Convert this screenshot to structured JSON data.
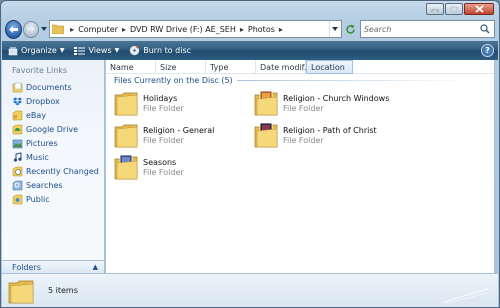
{
  "window": {
    "caption_buttons": [
      "minimize",
      "maximize",
      "close"
    ]
  },
  "address": {
    "crumbs": [
      "Computer",
      "DVD RW Drive (F:) AE_SEH",
      "Photos"
    ],
    "search_placeholder": "Search"
  },
  "toolbar": {
    "organize": "Organize",
    "views": "Views",
    "burn": "Burn to disc",
    "help": "?"
  },
  "nav": {
    "title": "Favorite Links",
    "items": [
      {
        "label": "Documents",
        "icon": "documents-icon"
      },
      {
        "label": "Dropbox",
        "icon": "dropbox-icon"
      },
      {
        "label": "eBay",
        "icon": "ebay-icon"
      },
      {
        "label": "Google Drive",
        "icon": "google-drive-icon"
      },
      {
        "label": "Pictures",
        "icon": "pictures-icon"
      },
      {
        "label": "Music",
        "icon": "music-icon"
      },
      {
        "label": "Recently Changed",
        "icon": "recently-changed-icon"
      },
      {
        "label": "Searches",
        "icon": "searches-icon"
      },
      {
        "label": "Public",
        "icon": "public-icon"
      }
    ],
    "folders_label": "Folders"
  },
  "columns": [
    "Name",
    "Size",
    "Type",
    "Date modif...",
    "Location"
  ],
  "group": {
    "label": "Files Currently on the Disc (5)"
  },
  "items": [
    {
      "name": "Holidays",
      "type": "File Folder",
      "variant": "plain"
    },
    {
      "name": "Religion - Church Windows",
      "type": "File Folder",
      "variant": "photo"
    },
    {
      "name": "Religion - General",
      "type": "File Folder",
      "variant": "plain"
    },
    {
      "name": "Religion - Path of Christ",
      "type": "File Folder",
      "variant": "photo-dark"
    },
    {
      "name": "Seasons",
      "type": "File Folder",
      "variant": "photo-blue"
    }
  ],
  "details": {
    "count": "5 items"
  },
  "colors": {
    "chrome": "#b3cde2",
    "toolbar": "#2d5b7f",
    "link": "#1f4f8a",
    "group": "#1c4d8a"
  }
}
